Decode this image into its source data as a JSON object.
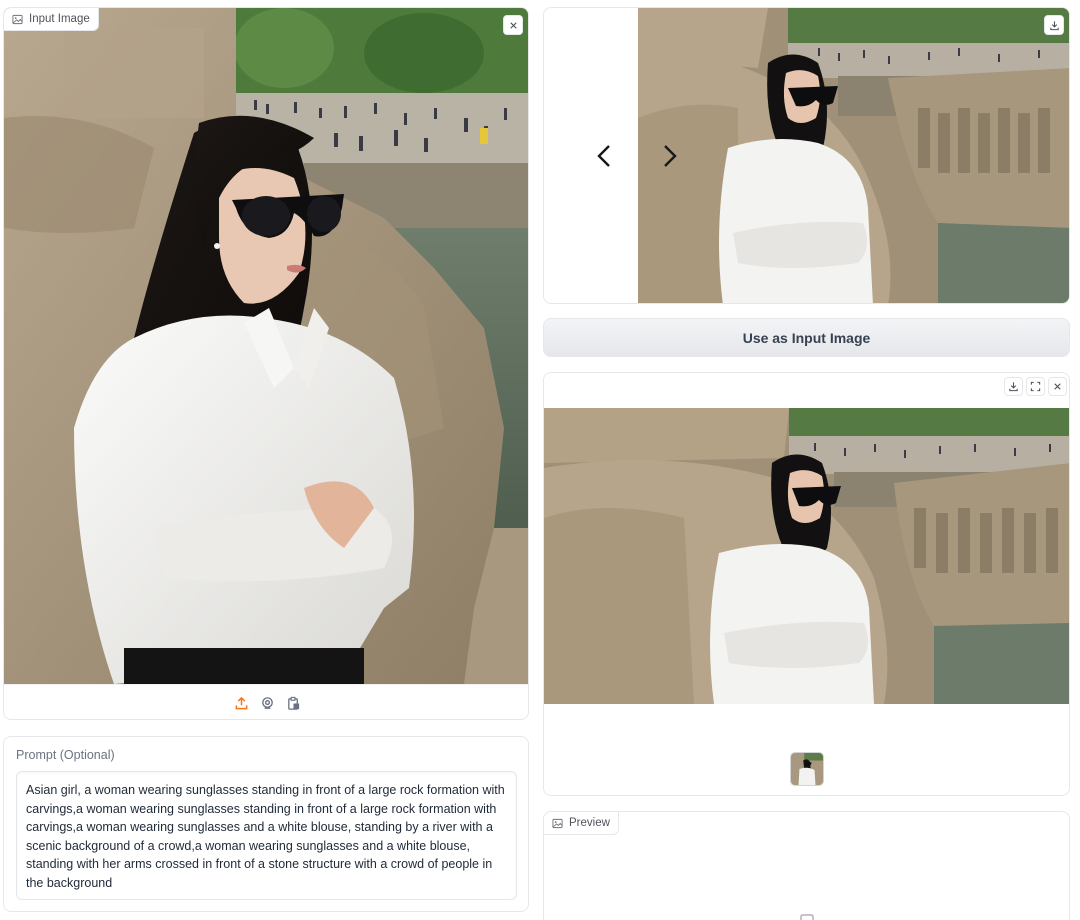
{
  "input_image": {
    "label": "Input Image",
    "label_icon": "image-icon",
    "close_icon": "close-icon",
    "actions": [
      {
        "name": "upload-icon",
        "accent": "#f97316"
      },
      {
        "name": "webcam-icon"
      },
      {
        "name": "clipboard-icon"
      }
    ]
  },
  "prompt": {
    "label": "Prompt (Optional)",
    "value": "Asian girl, a woman wearing sunglasses standing in front of a large rock formation with carvings,a woman wearing sunglasses standing in front of a large rock formation with carvings,a woman wearing sunglasses and a white blouse, standing by a river with a scenic background of a crowd,a woman wearing sunglasses and a white blouse, standing with her arms crossed in front of a stone structure with a crowd of people in the background"
  },
  "gallery": {
    "prev_icon": "chevron-left-icon",
    "next_icon": "chevron-right-icon",
    "download_icon": "download-icon"
  },
  "use_button": {
    "label": "Use as Input Image"
  },
  "output": {
    "toolbar": [
      "download-icon",
      "fullscreen-icon",
      "close-icon"
    ]
  },
  "preview": {
    "label": "Preview",
    "label_icon": "image-icon"
  },
  "colors": {
    "accent": "#f97316",
    "border": "#e5e7eb",
    "button_bg": "#e5e7eb"
  }
}
